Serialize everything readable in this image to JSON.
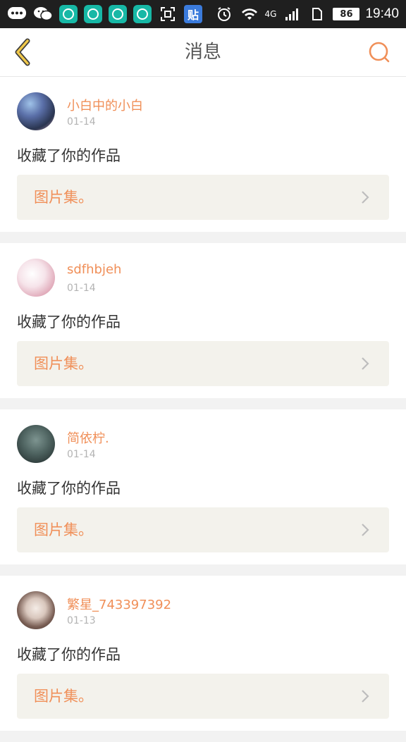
{
  "status_bar": {
    "battery": "86",
    "network": "4G",
    "time": "19:40",
    "tieba_label": "贴"
  },
  "header": {
    "title": "消息"
  },
  "colors": {
    "accent": "#f08f58",
    "back_icon": "#e6b83a",
    "text": "#333333",
    "muted": "#b3b3b3",
    "link_bg": "#f3f2ec"
  },
  "messages": [
    {
      "username": "小白中的小白",
      "date": "01-14",
      "action": "收藏了你的作品",
      "work": "图片集。"
    },
    {
      "username": "sdfhbjeh",
      "date": "01-14",
      "action": "收藏了你的作品",
      "work": "图片集。"
    },
    {
      "username": "简依柠.",
      "date": "01-14",
      "action": "收藏了你的作品",
      "work": "图片集。"
    },
    {
      "username": "繁星_743397392",
      "date": "01-13",
      "action": "收藏了你的作品",
      "work": "图片集。"
    }
  ]
}
